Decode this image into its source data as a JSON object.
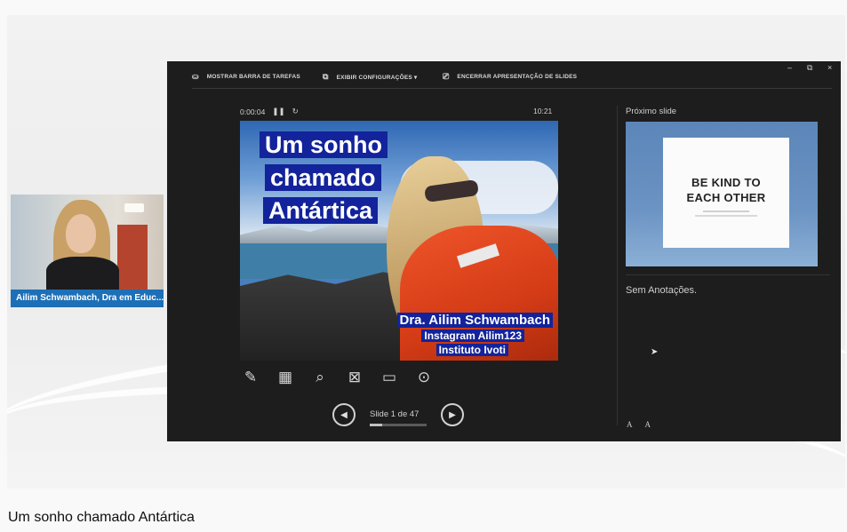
{
  "presenter": {
    "toolbar": {
      "taskbar_label": "MOSTRAR BARRA DE TAREFAS",
      "settings_label": "EXIBIR CONFIGURAÇÕES ▾",
      "end_label": "ENCERRAR APRESENTAÇÃO DE SLIDES"
    },
    "window_controls": [
      "–",
      "⧉",
      "×"
    ],
    "timer": "0:00:04",
    "clock": "10:21",
    "current_slide": {
      "title_lines": [
        "Um sonho",
        "chamado",
        "Antártica"
      ],
      "author": "Dra. Ailim Schwambach",
      "instagram": "Instagram Ailim123",
      "institution": "Instituto Ivoti"
    },
    "tools": [
      "pen-icon",
      "slides-grid-icon",
      "zoom-icon",
      "black-screen-icon",
      "subtitles-icon",
      "more-options-icon"
    ],
    "navigation": {
      "counter": "Slide 1 de 47",
      "progress": 0.0213
    },
    "next_slide": {
      "label": "Próximo slide",
      "title_lines": [
        "BE KIND TO",
        "EACH OTHER"
      ]
    },
    "notes": "Sem Anotações.",
    "font_buttons": [
      "A",
      "A"
    ]
  },
  "webcam": {
    "name": "Ailim Schwambach, Dra em Educ..."
  },
  "video": {
    "title": "Um sonho chamado Antártica"
  },
  "colors": {
    "presenter_bg": "#1d1d1d",
    "slide_title_bg": "#12239b",
    "name_tag_bg": "#1d6fb7"
  }
}
